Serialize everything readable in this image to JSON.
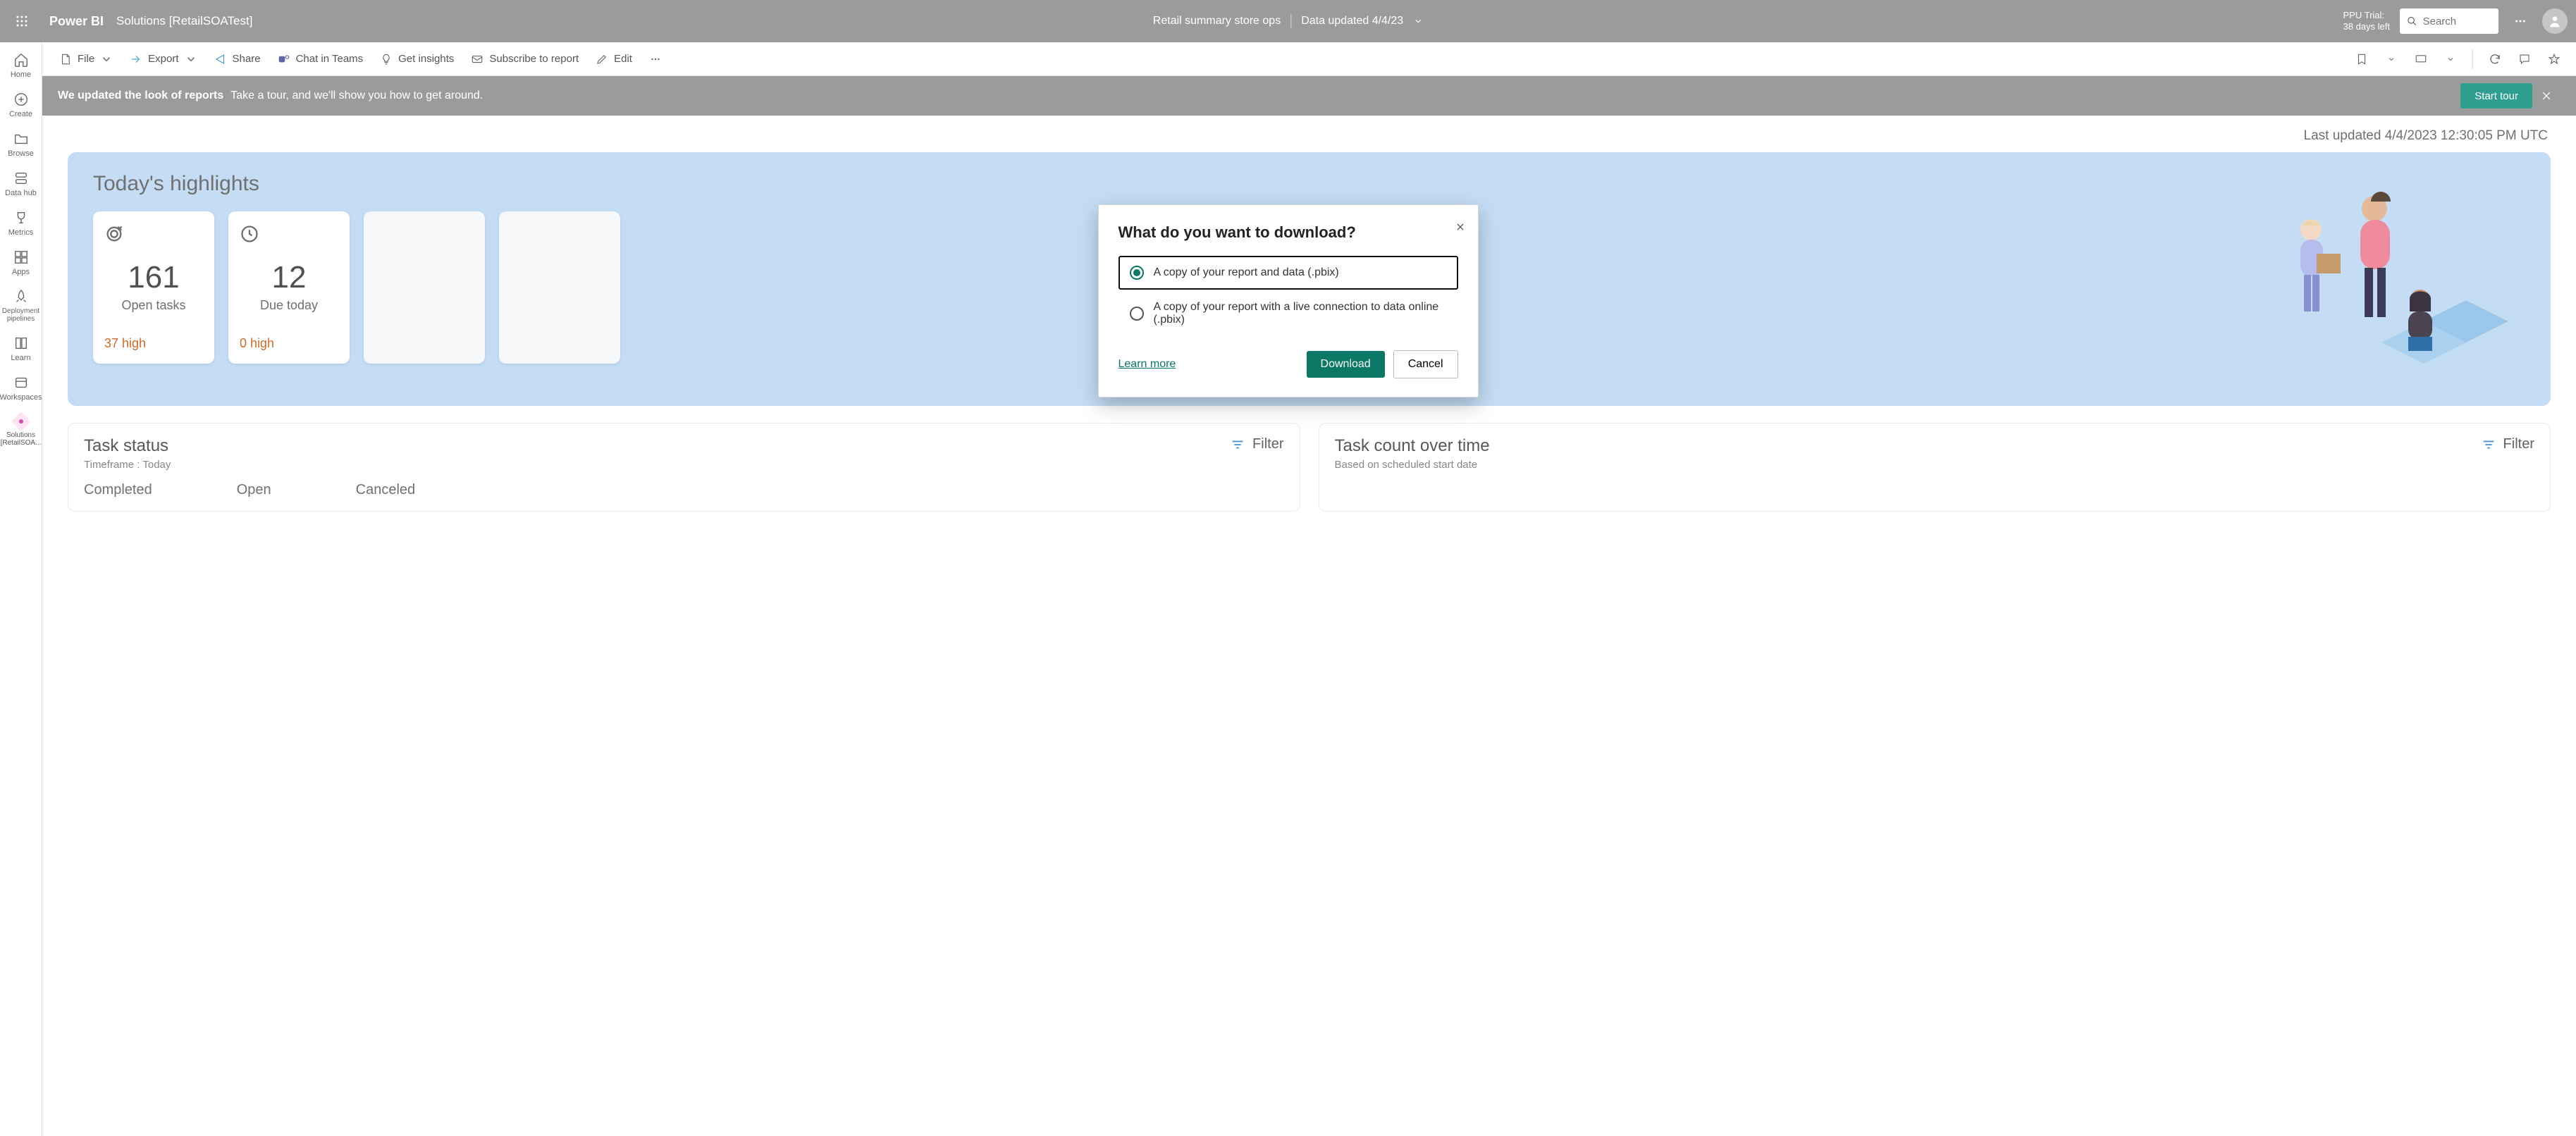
{
  "topbar": {
    "brand": "Power BI",
    "workspace": "Solutions [RetailSOATest]",
    "reportName": "Retail summary store ops",
    "dataUpdated": "Data updated 4/4/23",
    "trialLine1": "PPU Trial:",
    "trialLine2": "38 days left",
    "searchPlaceholder": "Search"
  },
  "leftnav": {
    "items": [
      {
        "label": "Home"
      },
      {
        "label": "Create"
      },
      {
        "label": "Browse"
      },
      {
        "label": "Data hub"
      },
      {
        "label": "Metrics"
      },
      {
        "label": "Apps"
      },
      {
        "label": "Deployment pipelines"
      },
      {
        "label": "Learn"
      },
      {
        "label": "Workspaces"
      },
      {
        "label": "Solutions [RetailSOA..."
      }
    ]
  },
  "actionbar": {
    "file": "File",
    "export": "Export",
    "share": "Share",
    "chatTeams": "Chat in Teams",
    "getInsights": "Get insights",
    "subscribe": "Subscribe to report",
    "edit": "Edit"
  },
  "banner": {
    "bold": "We updated the look of reports",
    "text": "Take a tour, and we'll show you how to get around.",
    "button": "Start tour"
  },
  "report": {
    "lastUpdated": "Last updated 4/4/2023 12:30:05 PM UTC",
    "heroTitle": "Today's highlights",
    "cards": [
      {
        "value": "161",
        "label": "Open tasks",
        "badge": "37 high"
      },
      {
        "value": "12",
        "label": "Due today",
        "badge": "0 high"
      }
    ],
    "taskStatus": {
      "title": "Task status",
      "subtitle": "Timeframe : Today",
      "filterLabel": "Filter",
      "columns": [
        "Completed",
        "Open",
        "Canceled"
      ]
    },
    "taskCount": {
      "title": "Task count over time",
      "subtitle": "Based on scheduled start date",
      "filterLabel": "Filter"
    }
  },
  "modal": {
    "title": "What do you want to download?",
    "option1": "A copy of your report and data (.pbix)",
    "option2": "A copy of your report with a live connection to data online (.pbix)",
    "learnMore": "Learn more",
    "download": "Download",
    "cancel": "Cancel"
  }
}
